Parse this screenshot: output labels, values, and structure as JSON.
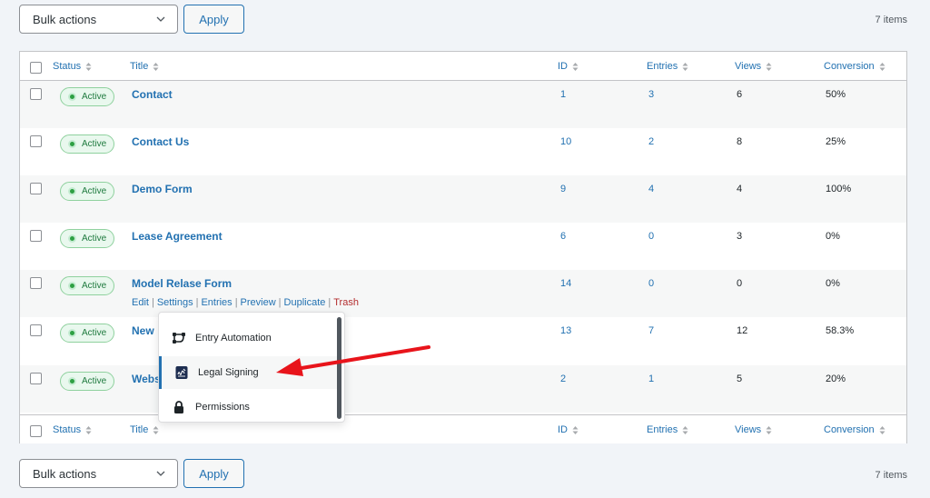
{
  "colors": {
    "accent": "#2271b1",
    "active_badge_bg": "#e9f8ee",
    "active_badge_dot": "#2ea043",
    "trash": "#b32d2e",
    "annotation_arrow": "#e8141b"
  },
  "tablenav_top": {
    "bulk_label": "Bulk actions",
    "apply_label": "Apply",
    "items_count": "7 items"
  },
  "tablenav_bottom": {
    "bulk_label": "Bulk actions",
    "apply_label": "Apply",
    "items_count": "7 items"
  },
  "columns": {
    "status": "Status",
    "title": "Title",
    "id": "ID",
    "entries": "Entries",
    "views": "Views",
    "conversion": "Conversion"
  },
  "rows": [
    {
      "status": "Active",
      "title": "Contact",
      "id": "1",
      "entries": "3",
      "views": "6",
      "conversion": "50%"
    },
    {
      "status": "Active",
      "title": "Contact Us",
      "id": "10",
      "entries": "2",
      "views": "8",
      "conversion": "25%"
    },
    {
      "status": "Active",
      "title": "Demo Form",
      "id": "9",
      "entries": "4",
      "views": "4",
      "conversion": "100%"
    },
    {
      "status": "Active",
      "title": "Lease Agreement",
      "id": "6",
      "entries": "0",
      "views": "3",
      "conversion": "0%"
    },
    {
      "status": "Active",
      "title": "Model Relase Form",
      "id": "14",
      "entries": "0",
      "views": "0",
      "conversion": "0%"
    },
    {
      "status": "Active",
      "title": "New",
      "id": "13",
      "entries": "7",
      "views": "12",
      "conversion": "58.3%"
    },
    {
      "status": "Active",
      "title": "Webs",
      "id": "2",
      "entries": "1",
      "views": "5",
      "conversion": "20%"
    }
  ],
  "row_actions": {
    "edit": "Edit",
    "settings": "Settings",
    "entries": "Entries",
    "preview": "Preview",
    "duplicate": "Duplicate",
    "trash": "Trash"
  },
  "settings_menu": {
    "items": [
      {
        "label": "Entry Automation",
        "icon": "automation-icon"
      },
      {
        "label": "Legal Signing",
        "icon": "signature-icon"
      },
      {
        "label": "Permissions",
        "icon": "lock-icon"
      }
    ]
  }
}
